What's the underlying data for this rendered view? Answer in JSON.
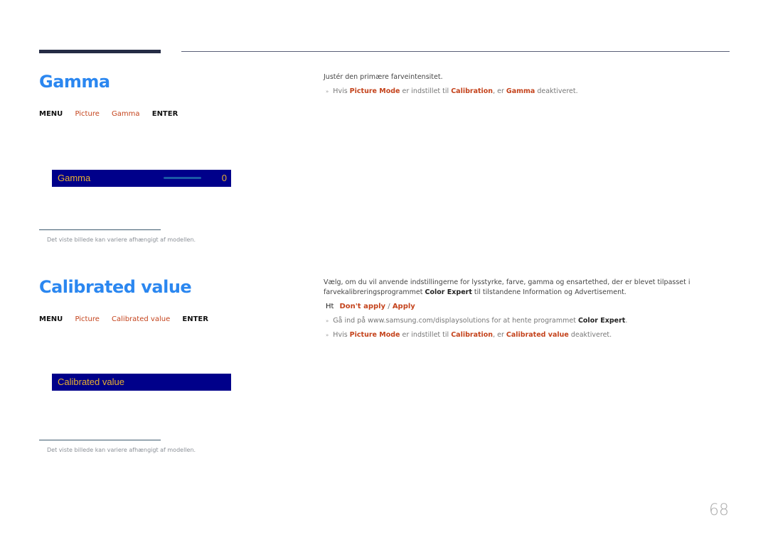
{
  "sections": [
    {
      "title": "Gamma",
      "menu_path": [
        "MENU",
        "Picture",
        "Gamma",
        "ENTER"
      ],
      "osd": {
        "label": "Gamma",
        "value": "0"
      },
      "note": "Det viste billede kan variere afhængigt af modellen.",
      "description": "Justér den primære farveintensitet.",
      "bullets": [
        {
          "parts": [
            "Hvis ",
            "Picture Mode",
            " er indstillet til ",
            "Calibration",
            ", er ",
            "Gamma",
            " deaktiveret."
          ]
        }
      ]
    },
    {
      "title": "Calibrated value",
      "menu_path": [
        "MENU",
        "Picture",
        "Calibrated value",
        "ENTER"
      ],
      "osd": {
        "label": "Calibrated value"
      },
      "note": "Det viste billede kan variere afhængigt af modellen.",
      "description_line1": "Vælg, om du vil anvende indstillingerne for lysstyrke, farve, gamma og ensartethed, der er blevet tilpasset i",
      "description_line2_parts": [
        "farvekalibreringsprogrammet ",
        "Color Expert",
        " til tilstandene Information og Advertisement."
      ],
      "options": {
        "prefix": "Ht",
        "first": "Don't apply",
        "sep": " / ",
        "second": "Apply"
      },
      "bullets": [
        {
          "parts": [
            "Gå ind på www.samsung.com/displaysolutions for at hente programmet ",
            "Color Expert",
            "."
          ]
        },
        {
          "parts": [
            "Hvis ",
            "Picture Mode",
            " er indstillet til ",
            "Calibration",
            ", er ",
            "Calibrated value",
            " deaktiveret."
          ]
        }
      ]
    }
  ],
  "page_number": "68",
  "colors": {
    "heading": "#2b87f0",
    "accent": "#c4431c",
    "osd_bg": "#00008a",
    "osd_text": "#e8b030"
  }
}
